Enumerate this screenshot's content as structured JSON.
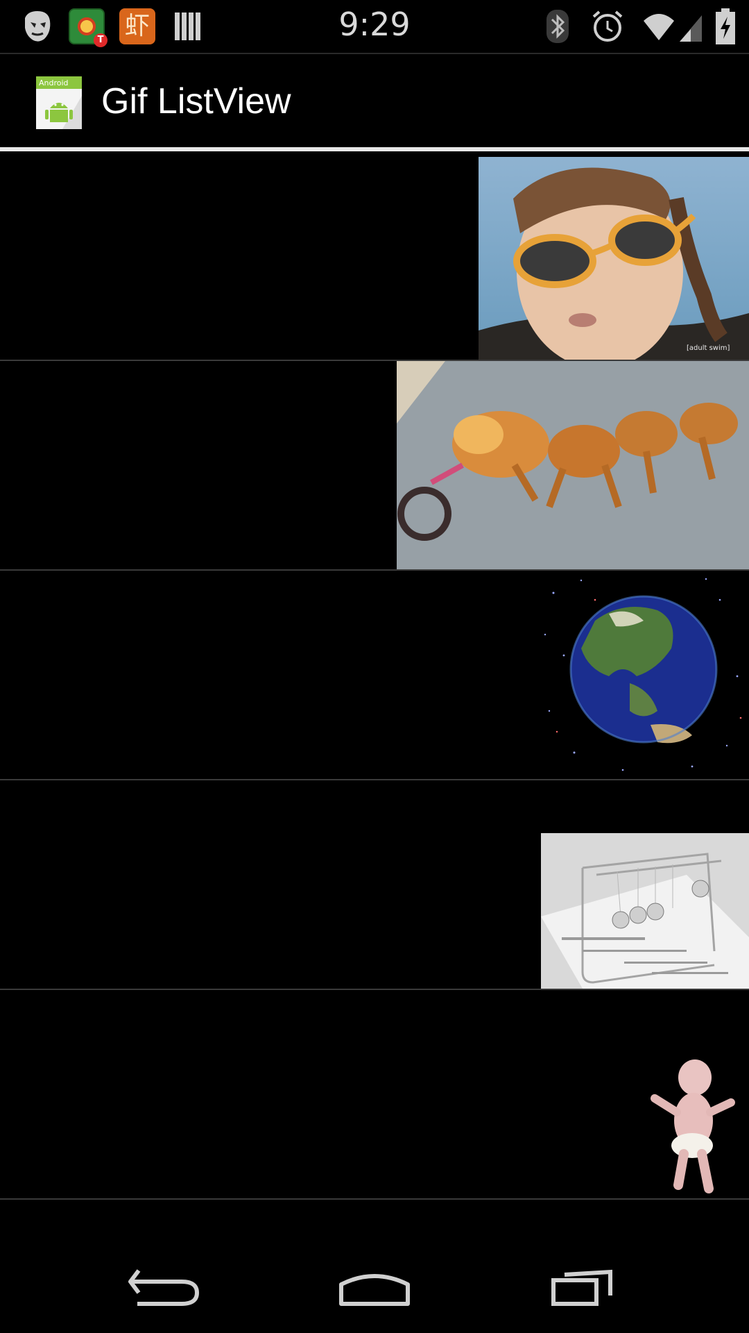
{
  "status_bar": {
    "time": "9:29",
    "notification_icons": [
      "mask-icon",
      "game-icon",
      "xia-app-icon",
      "bars-icon"
    ],
    "xia_glyph": "虾",
    "game_badge": "T",
    "system_icons": [
      "bluetooth-icon",
      "alarm-icon",
      "wifi-icon",
      "signal-icon",
      "battery-charging-icon"
    ]
  },
  "action_bar": {
    "app_icon": "android-app-icon",
    "app_icon_label": "Android",
    "title": "Gif ListView"
  },
  "list": {
    "items": [
      {
        "gif": "boy-sunglasses-gif",
        "watermark": "[adult swim]"
      },
      {
        "gif": "running-dogs-gif"
      },
      {
        "gif": "rotating-earth-gif"
      },
      {
        "gif": "newtons-cradle-gif"
      },
      {
        "gif": "dancing-baby-gif"
      }
    ]
  },
  "nav_bar": {
    "buttons": [
      "back-icon",
      "home-icon",
      "recents-icon"
    ]
  },
  "colors": {
    "background": "#000000",
    "divider": "#3a3a3a",
    "action_bar_divider": "#e8e8e8",
    "status_text": "#d9d9d9"
  }
}
